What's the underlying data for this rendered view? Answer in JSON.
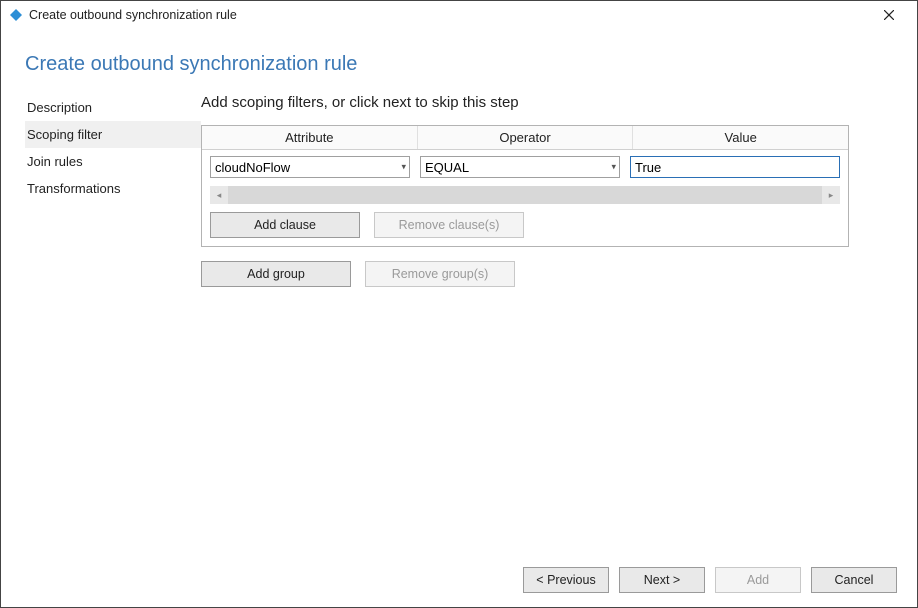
{
  "window": {
    "title": "Create outbound synchronization rule"
  },
  "page": {
    "title": "Create outbound synchronization rule"
  },
  "sidebar": {
    "items": [
      {
        "label": "Description"
      },
      {
        "label": "Scoping filter"
      },
      {
        "label": "Join rules"
      },
      {
        "label": "Transformations"
      }
    ],
    "active_index": 1
  },
  "main": {
    "instruction": "Add scoping filters, or click next to skip this step",
    "columns": {
      "attribute": "Attribute",
      "operator": "Operator",
      "value": "Value"
    },
    "row": {
      "attribute_selected": "cloudNoFlow",
      "operator_selected": "EQUAL",
      "value_text": "True"
    },
    "buttons": {
      "add_clause": "Add clause",
      "remove_clauses": "Remove clause(s)",
      "add_group": "Add group",
      "remove_groups": "Remove group(s)"
    }
  },
  "footer": {
    "previous": "< Previous",
    "next": "Next >",
    "add": "Add",
    "cancel": "Cancel"
  }
}
